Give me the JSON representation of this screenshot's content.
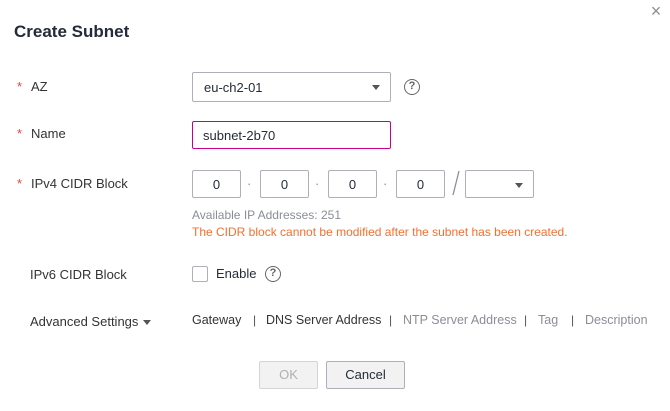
{
  "dialog": {
    "title": "Create Subnet",
    "close_glyph": "×"
  },
  "az": {
    "required_mark": "*",
    "label": "AZ",
    "value": "eu-ch2-01",
    "help_glyph": "?"
  },
  "name": {
    "required_mark": "*",
    "label": "Name",
    "value": "subnet-2b70"
  },
  "ipv4": {
    "required_mark": "*",
    "label": "IPv4 CIDR Block",
    "octets": [
      "0",
      "0",
      "0",
      "0"
    ],
    "separator": "·",
    "mask_value": "",
    "available_text": "Available IP Addresses: 251",
    "warning_text": "The CIDR block cannot be modified after the subnet has been created."
  },
  "ipv6": {
    "label": "IPv6 CIDR Block",
    "enable_label": "Enable",
    "enabled": false,
    "help_glyph": "?"
  },
  "advanced": {
    "label": "Advanced Settings",
    "items": [
      "Gateway",
      "DNS Server Address",
      "NTP Server Address",
      "Tag",
      "Description"
    ],
    "separator": "|"
  },
  "footer": {
    "ok_label": "OK",
    "cancel_label": "Cancel"
  },
  "colors": {
    "required": "#e8453c",
    "warning": "#f66f2e",
    "focus_border": "#c7008f",
    "hint": "#8a8e99"
  }
}
